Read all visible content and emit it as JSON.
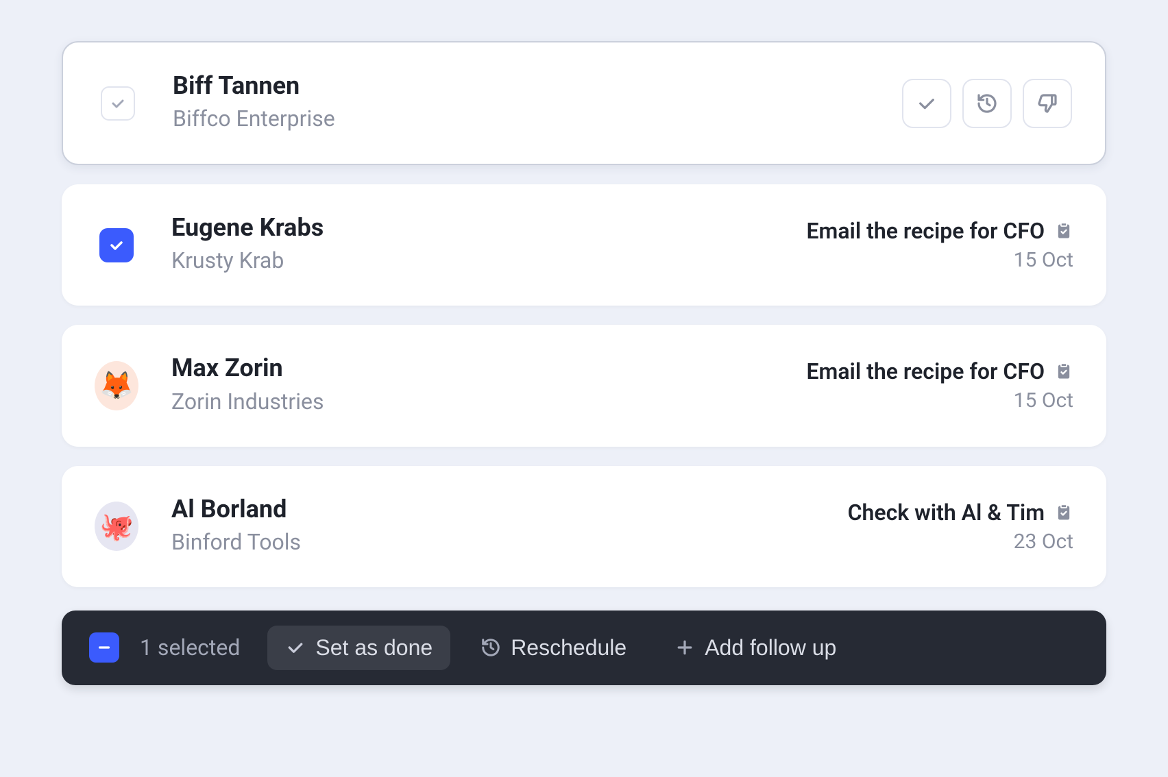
{
  "items": [
    {
      "name": "Biff Tannen",
      "company": "Biffco Enterprise",
      "selected": false,
      "hover": true,
      "task": null,
      "date": null,
      "avatar": null
    },
    {
      "name": "Eugene Krabs",
      "company": "Krusty Krab",
      "selected": true,
      "hover": false,
      "task": "Email the recipe for CFO",
      "date": "15 Oct",
      "avatar": null
    },
    {
      "name": "Max Zorin",
      "company": "Zorin Industries",
      "selected": false,
      "hover": false,
      "task": "Email the recipe for CFO",
      "date": "15 Oct",
      "avatar": {
        "emoji": "🦊",
        "bg": "peach"
      }
    },
    {
      "name": "Al Borland",
      "company": "Binford Tools",
      "selected": false,
      "hover": false,
      "task": "Check with Al & Tim",
      "date": "23 Oct",
      "avatar": {
        "emoji": "🐙",
        "bg": "lilac"
      }
    }
  ],
  "actionBar": {
    "selectedCount": "1 selected",
    "setDone": "Set as done",
    "reschedule": "Reschedule",
    "addFollowUp": "Add follow up"
  }
}
